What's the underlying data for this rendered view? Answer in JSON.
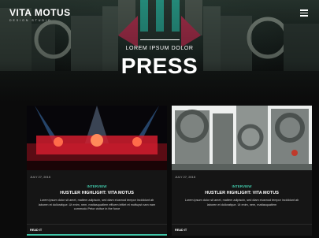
{
  "header": {
    "logo": "VITA MOTUS",
    "logo_subtitle": "DESIGN STUDIO",
    "menu_icon": "hamburger-icon"
  },
  "hero": {
    "kicker": "LOREM IPSUM DOLOR",
    "title": "PRESS"
  },
  "cards": [
    {
      "date": "JULY 27, 2015",
      "badge": "INTERVIEW",
      "title": "HUSTLER HIGHLIGHT: VITA MOTUS",
      "excerpt": "Lorem ipsum dolor sit amet, mattem adipiscin, sed diam eiusmod tempor incididunt ab laboren et dollorafque. Ut enim, nem, mattasquatlem efficem leltiet et moftupst nam eam commodo Petor civitue in the force",
      "read_more": "READ IT"
    },
    {
      "date": "JULY 27, 2015",
      "badge": "INTERVIEW",
      "title": "HUSTLER HIGHLIGHT: VITA MOTUS",
      "excerpt": "Lorem ipsum dolor sit amet, mattem adipiscin, sed diam eiusmod tempor incididunt ab laboren et dollorafque. Ut enim, nem, mattasquatlem",
      "read_more": "READ IT"
    }
  ],
  "colors": {
    "accent": "#3fc3a6",
    "background": "#0b0b0b"
  }
}
